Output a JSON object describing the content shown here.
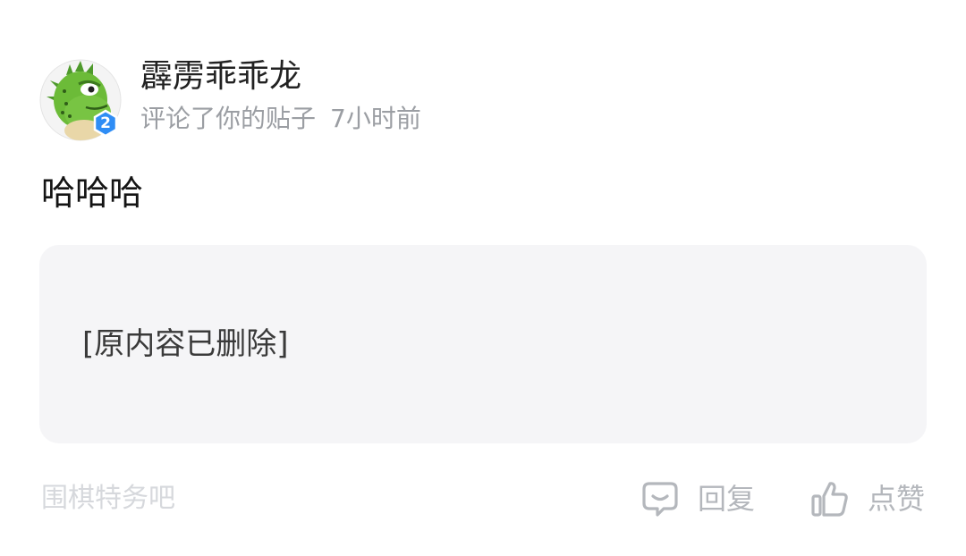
{
  "notification": {
    "username": "霹雳乖乖龙",
    "action_text": "评论了你的贴子",
    "time": "7小时前",
    "avatar_badge": "2",
    "comment": "哈哈哈",
    "quoted_content": "[原内容已删除]",
    "forum_name": "围棋特务吧",
    "reply_label": "回复",
    "like_label": "点赞"
  },
  "colors": {
    "username": "#222222",
    "meta": "#9b9ea3",
    "quote_bg": "#f5f5f7",
    "footer_text": "#b4b7bc",
    "forum_name": "#d6d8dc",
    "badge": "#2f8df5"
  }
}
